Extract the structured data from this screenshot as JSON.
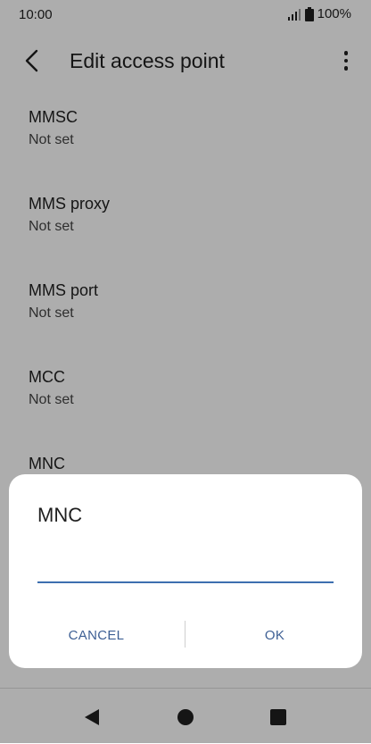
{
  "status_bar": {
    "time": "10:00",
    "battery": "100%",
    "icons": [
      "signal-icon",
      "battery-icon"
    ]
  },
  "app_bar": {
    "title": "Edit access point",
    "icons": [
      "back-arrow-icon",
      "overflow-menu-icon"
    ]
  },
  "settings": [
    {
      "title": "MMSC",
      "value": "Not set"
    },
    {
      "title": "MMS proxy",
      "value": "Not set"
    },
    {
      "title": "MMS port",
      "value": "Not set"
    },
    {
      "title": "MCC",
      "value": "Not set"
    },
    {
      "title": "MNC",
      "value": ""
    }
  ],
  "dialog": {
    "title": "MNC",
    "input_value": "",
    "cancel_label": "CANCEL",
    "ok_label": "OK"
  },
  "nav_bar": {
    "icons": [
      "back-triangle-icon",
      "home-circle-icon",
      "recents-square-icon"
    ]
  },
  "colors": {
    "accent": "#3d6fb0",
    "button_text": "#3d5f94",
    "scrim": "#000000"
  }
}
